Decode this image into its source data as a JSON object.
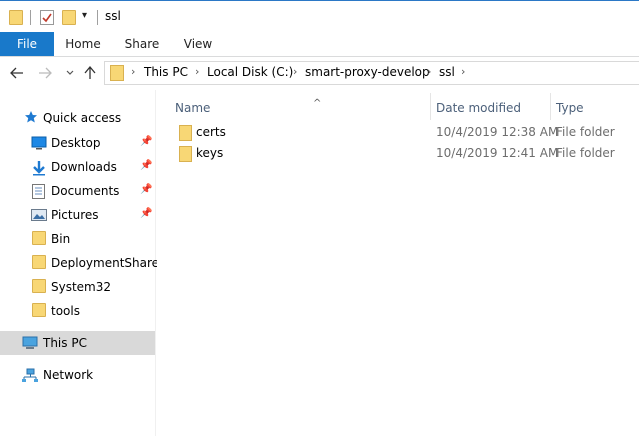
{
  "window": {
    "title": "ssl"
  },
  "ribbon": {
    "tabs": [
      {
        "label": "File"
      },
      {
        "label": "Home"
      },
      {
        "label": "Share"
      },
      {
        "label": "View"
      }
    ]
  },
  "address": {
    "crumbs": [
      "This PC",
      "Local Disk (C:)",
      "smart-proxy-develop",
      "ssl"
    ]
  },
  "sidebar": {
    "quick_access": "Quick access",
    "items": [
      {
        "label": "Desktop",
        "icon": "desktop-icon",
        "pinned": true
      },
      {
        "label": "Downloads",
        "icon": "download-arrow-icon",
        "pinned": true
      },
      {
        "label": "Documents",
        "icon": "document-icon",
        "pinned": true
      },
      {
        "label": "Pictures",
        "icon": "pictures-icon",
        "pinned": true
      },
      {
        "label": "Bin",
        "icon": "folder-icon",
        "pinned": false
      },
      {
        "label": "DeploymentShare",
        "icon": "folder-icon",
        "pinned": false
      },
      {
        "label": "System32",
        "icon": "folder-icon",
        "pinned": false
      },
      {
        "label": "tools",
        "icon": "folder-icon",
        "pinned": false
      }
    ],
    "this_pc": "This PC",
    "network": "Network"
  },
  "columns": {
    "name": "Name",
    "date": "Date modified",
    "type": "Type"
  },
  "files": [
    {
      "name": "certs",
      "date": "10/4/2019 12:38 AM",
      "type": "File folder"
    },
    {
      "name": "keys",
      "date": "10/4/2019 12:41 AM",
      "type": "File folder"
    }
  ],
  "colors": {
    "accent": "#1979ca",
    "folder": "#f8d775",
    "selected": "#d9d9d9",
    "header_text": "#4c607a"
  }
}
